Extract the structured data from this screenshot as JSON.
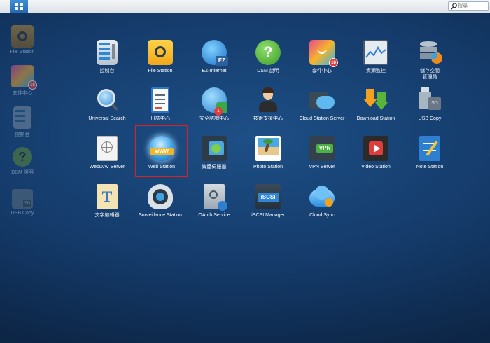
{
  "topbar": {
    "search_placeholder": "搜尋"
  },
  "shortcuts": [
    {
      "label": "File Station",
      "icon": "folder-icon"
    },
    {
      "label": "套件中心",
      "icon": "package-center-icon",
      "badge": "18"
    },
    {
      "label": "控制台",
      "icon": "control-panel-icon"
    },
    {
      "label": "DSM 說明",
      "icon": "help-icon"
    },
    {
      "label": "USB Copy",
      "icon": "usb-icon"
    }
  ],
  "apps": [
    {
      "label": "控制台",
      "icon": "control-panel-icon"
    },
    {
      "label": "File Station",
      "icon": "folder-icon"
    },
    {
      "label": "EZ-Internet",
      "icon": "ez-internet-icon"
    },
    {
      "label": "DSM 說明",
      "icon": "help-icon"
    },
    {
      "label": "套件中心",
      "icon": "package-center-icon",
      "badge": "18"
    },
    {
      "label": "資源監控",
      "icon": "resource-monitor-icon"
    },
    {
      "label": "儲存空間",
      "label2": "管理員",
      "icon": "storage-manager-icon"
    },
    {
      "label": "Universal Search",
      "icon": "search-icon"
    },
    {
      "label": "日誌中心",
      "icon": "log-center-icon"
    },
    {
      "label": "安全諮詢中心",
      "icon": "security-advisor-icon"
    },
    {
      "label": "技術支援中心",
      "icon": "support-center-icon"
    },
    {
      "label": "Cloud Station Server",
      "icon": "cloud-station-icon"
    },
    {
      "label": "Download Station",
      "icon": "download-icon"
    },
    {
      "label": "USB Copy",
      "icon": "usb-icon"
    },
    {
      "label": "WebDAV Server",
      "icon": "webdav-icon"
    },
    {
      "label": "Web Station",
      "icon": "www-globe-icon"
    },
    {
      "label": "媒體伺服器",
      "icon": "media-server-icon"
    },
    {
      "label": "Photo Station",
      "icon": "photo-icon"
    },
    {
      "label": "VPN Server",
      "icon": "vpn-icon"
    },
    {
      "label": "Video Station",
      "icon": "video-icon"
    },
    {
      "label": "Note Station",
      "icon": "note-icon"
    },
    {
      "label": "文字編輯器",
      "icon": "text-editor-icon"
    },
    {
      "label": "Surveillance Station",
      "icon": "camera-icon"
    },
    {
      "label": "OAuth Service",
      "icon": "oauth-icon"
    },
    {
      "label": "iSCSI Manager",
      "icon": "iscsi-icon"
    },
    {
      "label": "Cloud Sync",
      "icon": "cloud-sync-icon"
    }
  ],
  "colors": {
    "highlight_box": "#e02020",
    "topbar_button": "#2f7bc6"
  }
}
